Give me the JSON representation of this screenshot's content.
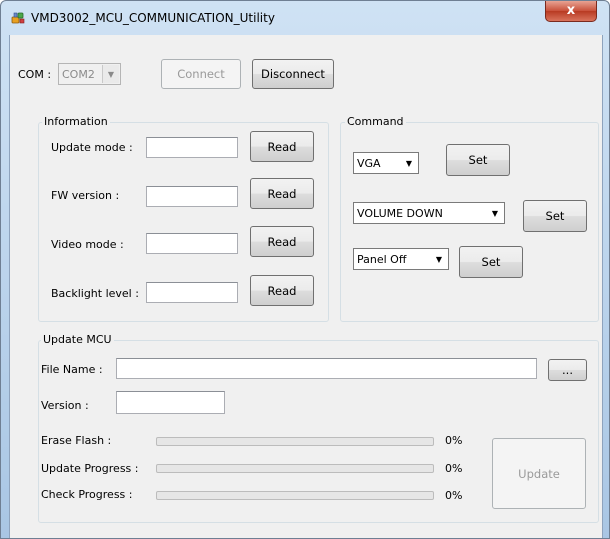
{
  "window": {
    "title": "VMD3002_MCU_COMMUNICATION_Utility",
    "close_glyph": "x"
  },
  "com": {
    "label": "COM :",
    "selected": "COM2",
    "connect": "Connect",
    "disconnect": "Disconnect"
  },
  "information": {
    "title": "Information",
    "rows": [
      {
        "label": "Update mode :",
        "value": "",
        "button": "Read"
      },
      {
        "label": "FW version :",
        "value": "",
        "button": "Read"
      },
      {
        "label": "Video mode :",
        "value": "",
        "button": "Read"
      },
      {
        "label": "Backlight level :",
        "value": "",
        "button": "Read"
      }
    ]
  },
  "command": {
    "title": "Command",
    "rows": [
      {
        "selected": "VGA",
        "button": "Set"
      },
      {
        "selected": "VOLUME DOWN",
        "button": "Set"
      },
      {
        "selected": "Panel Off",
        "button": "Set"
      }
    ]
  },
  "update_mcu": {
    "title": "Update MCU",
    "file_name_label": "File Name :",
    "file_name_value": "",
    "browse": "...",
    "version_label": "Version :",
    "version_value": "",
    "progress": [
      {
        "label": "Erase Flash :",
        "percent_text": "0%",
        "value": 0
      },
      {
        "label": "Update Progress :",
        "percent_text": "0%",
        "value": 0
      },
      {
        "label": "Check Progress :",
        "percent_text": "0%",
        "value": 0
      }
    ],
    "update_button": "Update"
  },
  "colors": {
    "progress_fill": "#06b025",
    "close_button": "#c8503a",
    "client_bg": "#f0f0f0"
  },
  "icons": {
    "app": "usb-plug-icon",
    "combo_arrow": "chevron-down-icon"
  }
}
